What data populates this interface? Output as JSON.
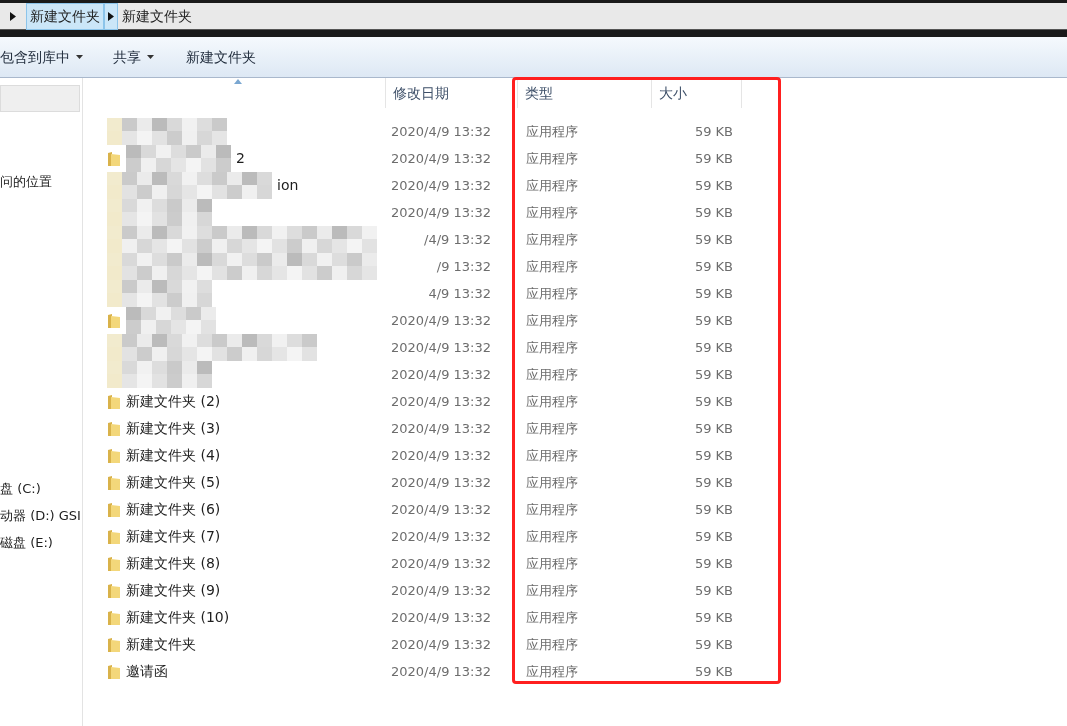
{
  "breadcrumb": [
    {
      "label": "新建文件夹",
      "selected": true
    },
    {
      "label": "新建文件夹",
      "selected": false
    }
  ],
  "toolbar": [
    {
      "label": "包含到库中",
      "dropdown": true
    },
    {
      "label": "共享",
      "dropdown": true
    },
    {
      "label": "新建文件夹",
      "dropdown": false
    }
  ],
  "sidebar": {
    "groups": [
      [
        "问的位置"
      ],
      [
        "盘 (C:)",
        "动器 (D:) GSI",
        "磁盘 (E:)"
      ]
    ]
  },
  "table": {
    "columns": [
      {
        "sorted": true
      },
      {
        "label": "修改日期",
        "sorted": false
      },
      {
        "label": "类型",
        "sorted": false
      },
      {
        "label": "大小",
        "sorted": false
      }
    ],
    "rows": [
      {
        "obscured": true,
        "icon_visible": false,
        "modified": "2020/4/9 13:32",
        "type": "应用程序",
        "size": "59 KB"
      },
      {
        "obscured": true,
        "icon_visible": true,
        "name": "2",
        "modified": "2020/4/9 13:32",
        "type": "应用程序",
        "size": "59 KB"
      },
      {
        "obscured": true,
        "icon_visible": false,
        "name": "ion",
        "modified": "2020/4/9 13:32",
        "type": "应用程序",
        "size": "59 KB"
      },
      {
        "obscured": true,
        "icon_visible": false,
        "modified": "2020/4/9 13:32",
        "type": "应用程序",
        "size": "59 KB"
      },
      {
        "obscured": true,
        "icon_visible": false,
        "modified": "/4/9 13:32",
        "type": "应用程序",
        "size": "59 KB"
      },
      {
        "obscured": true,
        "icon_visible": false,
        "modified": "/9 13:32",
        "type": "应用程序",
        "size": "59 KB"
      },
      {
        "obscured": true,
        "icon_visible": false,
        "modified": "4/9 13:32",
        "type": "应用程序",
        "size": "59 KB"
      },
      {
        "obscured": true,
        "icon_visible": true,
        "modified": "2020/4/9 13:32",
        "type": "应用程序",
        "size": "59 KB"
      },
      {
        "obscured": true,
        "icon_visible": false,
        "modified": "2020/4/9 13:32",
        "type": "应用程序",
        "size": "59 KB"
      },
      {
        "obscured": true,
        "icon_visible": false,
        "modified": "2020/4/9 13:32",
        "type": "应用程序",
        "size": "59 KB"
      },
      {
        "obscured": false,
        "icon_visible": true,
        "name": "新建文件夹 (2)",
        "modified": "2020/4/9 13:32",
        "type": "应用程序",
        "size": "59 KB"
      },
      {
        "obscured": false,
        "icon_visible": true,
        "name": "新建文件夹 (3)",
        "modified": "2020/4/9 13:32",
        "type": "应用程序",
        "size": "59 KB"
      },
      {
        "obscured": false,
        "icon_visible": true,
        "name": "新建文件夹 (4)",
        "modified": "2020/4/9 13:32",
        "type": "应用程序",
        "size": "59 KB"
      },
      {
        "obscured": false,
        "icon_visible": true,
        "name": "新建文件夹 (5)",
        "modified": "2020/4/9 13:32",
        "type": "应用程序",
        "size": "59 KB"
      },
      {
        "obscured": false,
        "icon_visible": true,
        "name": "新建文件夹 (6)",
        "modified": "2020/4/9 13:32",
        "type": "应用程序",
        "size": "59 KB"
      },
      {
        "obscured": false,
        "icon_visible": true,
        "name": "新建文件夹 (7)",
        "modified": "2020/4/9 13:32",
        "type": "应用程序",
        "size": "59 KB"
      },
      {
        "obscured": false,
        "icon_visible": true,
        "name": "新建文件夹 (8)",
        "modified": "2020/4/9 13:32",
        "type": "应用程序",
        "size": "59 KB"
      },
      {
        "obscured": false,
        "icon_visible": true,
        "name": "新建文件夹 (9)",
        "modified": "2020/4/9 13:32",
        "type": "应用程序",
        "size": "59 KB"
      },
      {
        "obscured": false,
        "icon_visible": true,
        "name": "新建文件夹 (10)",
        "modified": "2020/4/9 13:32",
        "type": "应用程序",
        "size": "59 KB"
      },
      {
        "obscured": false,
        "icon_visible": true,
        "name": "新建文件夹",
        "modified": "2020/4/9 13:32",
        "type": "应用程序",
        "size": "59 KB"
      },
      {
        "obscured": false,
        "icon_visible": true,
        "name": "邀请函",
        "modified": "2020/4/9 13:32",
        "type": "应用程序",
        "size": "59 KB"
      }
    ]
  }
}
